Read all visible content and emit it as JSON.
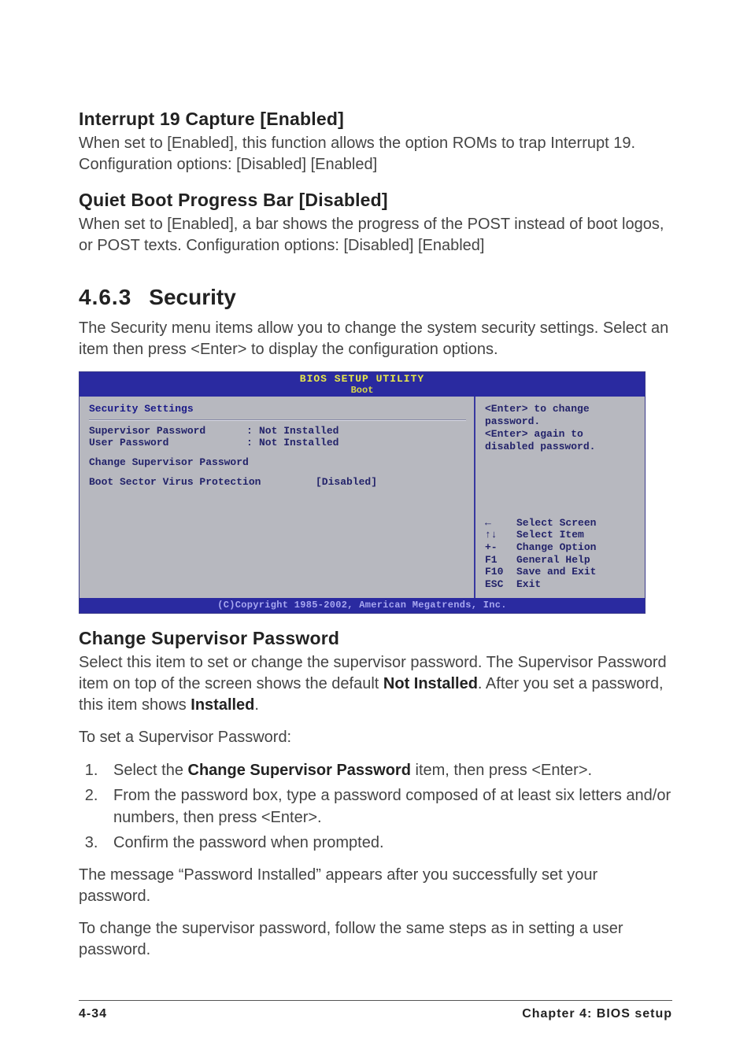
{
  "section1": {
    "heading": "Interrupt 19 Capture [Enabled]",
    "body": "When set to [Enabled], this function allows the option ROMs to trap Interrupt 19. Configuration options: [Disabled] [Enabled]"
  },
  "section2": {
    "heading": "Quiet Boot Progress Bar [Disabled]",
    "body": "When set to [Enabled], a bar shows the progress of the POST instead of boot logos, or POST texts. Configuration options: [Disabled] [Enabled]"
  },
  "chapter": {
    "number": "4.6.3",
    "title": "Security",
    "intro": "The Security menu items allow you to change the system security settings. Select an item then press <Enter> to display the configuration options."
  },
  "bios": {
    "title_line1": "BIOS SETUP UTILITY",
    "title_line2": "Boot",
    "left": {
      "section_title": "Security Settings",
      "supervisor": {
        "label": "Supervisor Password",
        "value": "Not Installed"
      },
      "user": {
        "label": "User Password",
        "value": "Not Installed"
      },
      "change_item": "Change Supervisor Password",
      "bootsector": {
        "label": "Boot Sector Virus Protection",
        "value": "[Disabled]"
      }
    },
    "right": {
      "help": "<Enter> to change password.\n<Enter> again to disabled password.",
      "nav": [
        {
          "key_glyph": "←",
          "desc": "Select Screen"
        },
        {
          "key_glyph": "↑↓",
          "desc": "Select Item"
        },
        {
          "key_glyph": "+-",
          "desc": "Change Option"
        },
        {
          "key_glyph": "F1",
          "desc": "General Help"
        },
        {
          "key_glyph": "F10",
          "desc": "Save and Exit"
        },
        {
          "key_glyph": "ESC",
          "desc": "Exit"
        }
      ]
    },
    "footer": "(C)Copyright 1985-2002, American Megatrends, Inc."
  },
  "change_pw": {
    "heading": "Change Supervisor Password",
    "para1_prefix": "Select this item to set or change the supervisor password. The Supervisor Password item on top of the screen shows the default ",
    "para1_bold1": "Not Installed",
    "para1_mid": ". After you set a password, this item shows ",
    "para1_bold2": "Installed",
    "para1_suffix": ".",
    "para2": "To set a Supervisor Password:",
    "steps": {
      "s1_prefix": "Select the ",
      "s1_bold": "Change Supervisor Password",
      "s1_suffix": " item, then press <Enter>.",
      "s2": "From the password box, type a password composed of at least six letters and/or numbers, then press <Enter>.",
      "s3": "Confirm the password when prompted."
    },
    "para3": "The message “Password Installed” appears after you successfully set your password.",
    "para4": "To change the supervisor password, follow the same steps as in setting a user password."
  },
  "footer": {
    "left": "4-34",
    "right": "Chapter 4: BIOS setup"
  }
}
